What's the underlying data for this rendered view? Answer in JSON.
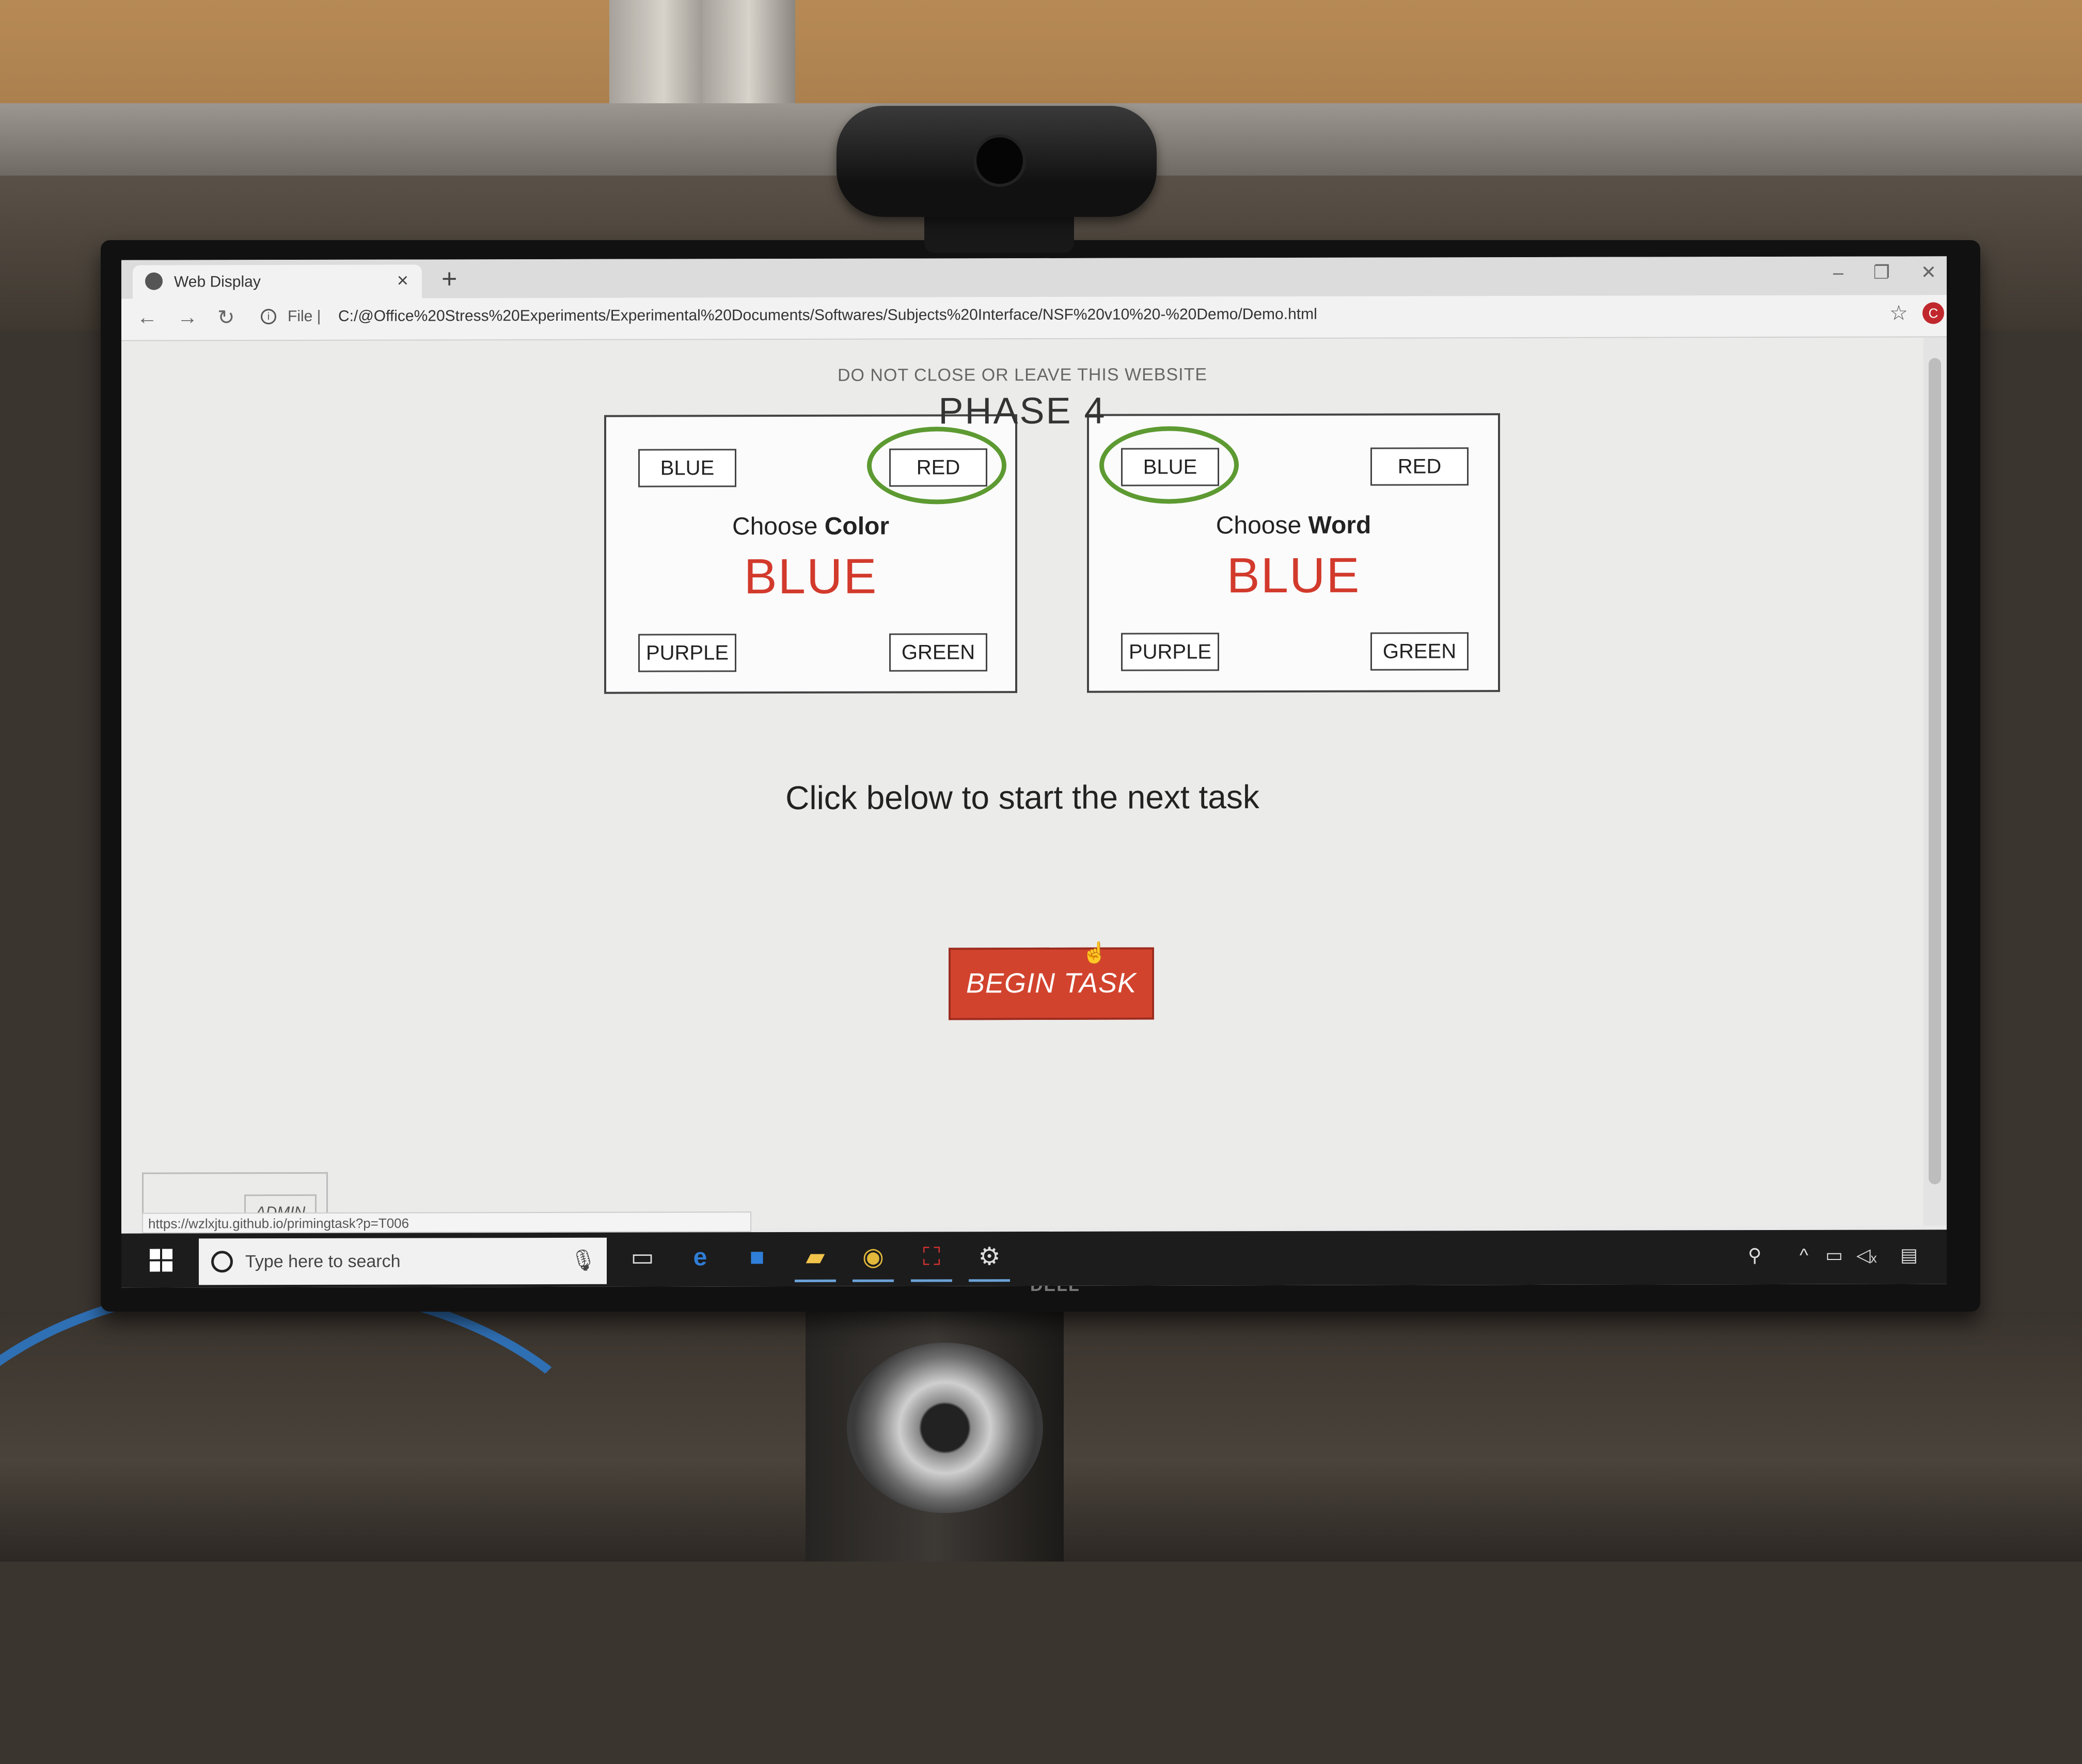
{
  "browser": {
    "tab_title": "Web Display",
    "tab_close": "×",
    "new_tab": "+",
    "scheme": "File |",
    "url": "C:/@Office%20Stress%20Experiments/Experimental%20Documents/Softwares/Subjects%20Interface/NSF%20v10%20-%20Demo/Demo.html",
    "profile_initial": "C",
    "status_url": "https://wzlxjtu.github.io/primingtask?p=T006"
  },
  "page": {
    "warning": "DO NOT CLOSE OR LEAVE THIS WEBSITE",
    "phase": "PHASE 4",
    "panels": [
      {
        "prompt_prefix": "Choose ",
        "prompt_emphasis": "Color",
        "stimulus": "BLUE",
        "options": [
          "BLUE",
          "RED",
          "PURPLE",
          "GREEN"
        ],
        "highlighted": "RED"
      },
      {
        "prompt_prefix": "Choose ",
        "prompt_emphasis": "Word",
        "stimulus": "BLUE",
        "options": [
          "BLUE",
          "RED",
          "PURPLE",
          "GREEN"
        ],
        "highlighted": "BLUE"
      }
    ],
    "instruction": "Click below to start the next task",
    "begin_button": "BEGIN TASK",
    "admin_label": "ADMIN"
  },
  "taskbar": {
    "search_placeholder": "Type here to search",
    "icons": [
      "windows-start-icon",
      "task-view-icon",
      "edge-icon",
      "store-icon",
      "file-explorer-icon",
      "chrome-icon",
      "acrobat-icon",
      "settings-icon"
    ]
  },
  "monitor_brand": "DELL",
  "colors": {
    "stimulus_red": "#d23a2c",
    "highlight_green": "#5d9a32",
    "button_red": "#d2432e"
  }
}
